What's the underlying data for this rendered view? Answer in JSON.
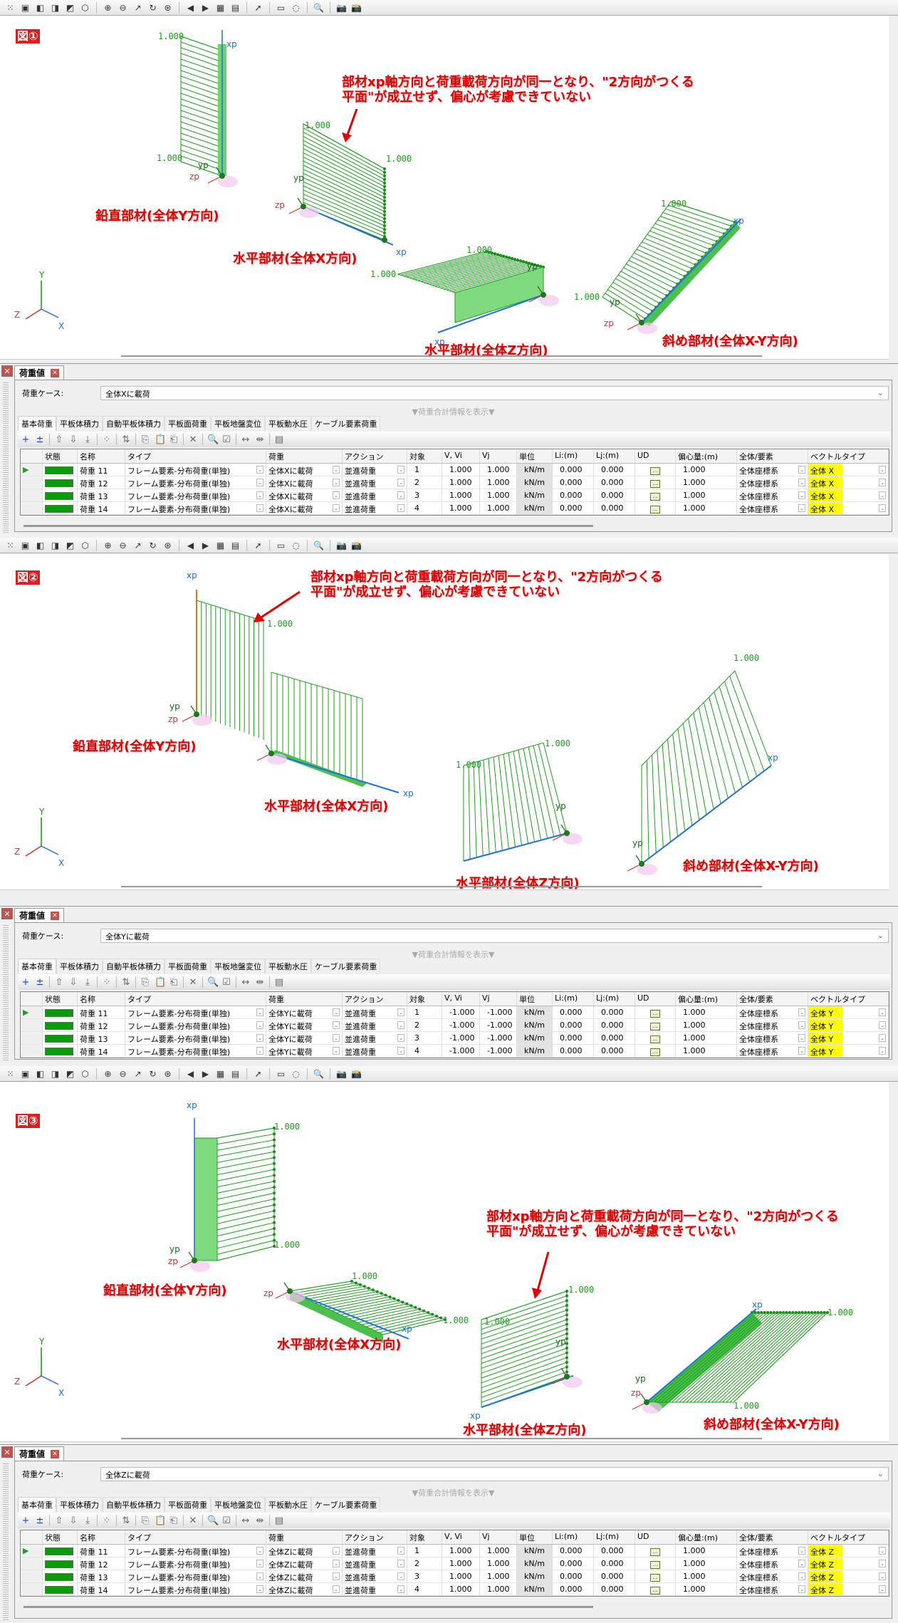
{
  "viewports": [
    {
      "figure_label": "図①",
      "annotation": [
        "部材xp軸方向と荷重載荷方向が同一となり、\"2方向がつくる",
        "平面\"が成立せず、偏心が考慮できていない"
      ],
      "member_labels": {
        "vertical": "鉛直部材(全体Y方向)",
        "horiz_x": "水平部材(全体X方向)",
        "horiz_z": "水平部材(全体Z方向)",
        "diagonal": "斜め部材(全体X-Y方向)"
      }
    },
    {
      "figure_label": "図②",
      "annotation": [
        "部材xp軸方向と荷重載荷方向が同一となり、\"2方向がつくる",
        "平面\"が成立せず、偏心が考慮できていない"
      ],
      "member_labels": {
        "vertical": "鉛直部材(全体Y方向)",
        "horiz_x": "水平部材(全体X方向)",
        "horiz_z": "水平部材(全体Z方向)",
        "diagonal": "斜め部材(全体X-Y方向)"
      }
    },
    {
      "figure_label": "図③",
      "annotation": [
        "部材xp軸方向と荷重載荷方向が同一となり、\"2方向がつくる",
        "平面\"が成立せず、偏心が考慮できていない"
      ],
      "member_labels": {
        "vertical": "鉛直部材(全体Y方向)",
        "horiz_x": "水平部材(全体X方向)",
        "horiz_z": "水平部材(全体Z方向)",
        "diagonal": "斜め部材(全体X-Y方向)"
      }
    }
  ],
  "value_label": "1.000",
  "axes": {
    "x": "X",
    "y": "Y",
    "z": "Z",
    "xp": "xp",
    "yp": "yp",
    "zp": "zp"
  },
  "colors": {
    "load": "#1aa01a",
    "member": "#1e6fe0",
    "annotation": "#e60000",
    "vector_highlight": "#ffff00"
  },
  "panel_common": {
    "tab_title": "荷重値",
    "case_label": "荷重ケース:",
    "info_toggle": "▼荷重合計情報を表示▼",
    "tabs": [
      "基本荷重",
      "平板体積力",
      "自動平板体積力",
      "平板面荷重",
      "平板地盤変位",
      "平板動水圧",
      "ケーブル要素荷重"
    ],
    "columns": [
      "",
      "状態",
      "名称",
      "タイプ",
      "荷重",
      "アクション",
      "対象",
      "V, Vi",
      "Vj",
      "単位",
      "Li:(m)",
      "Lj:(m)",
      "UD",
      "偏心量:(m)",
      "全体/要素",
      "ベクトルタイプ"
    ],
    "ud_button": "…"
  },
  "panels": [
    {
      "case_value": "全体Xに載荷",
      "rows": [
        {
          "name": "荷重 11",
          "type": "フレーム要素-分布荷重(単独)",
          "load": "全体Xに載荷",
          "action": "並進荷重",
          "target": "1",
          "vi": "1.000",
          "vj": "1.000",
          "unit": "kN/m",
          "li": "0.000",
          "lj": "0.000",
          "ecc": "1.000",
          "coord": "全体座標系",
          "vector": "全体 X"
        },
        {
          "name": "荷重 12",
          "type": "フレーム要素-分布荷重(単独)",
          "load": "全体Xに載荷",
          "action": "並進荷重",
          "target": "2",
          "vi": "1.000",
          "vj": "1.000",
          "unit": "kN/m",
          "li": "0.000",
          "lj": "0.000",
          "ecc": "1.000",
          "coord": "全体座標系",
          "vector": "全体 X"
        },
        {
          "name": "荷重 13",
          "type": "フレーム要素-分布荷重(単独)",
          "load": "全体Xに載荷",
          "action": "並進荷重",
          "target": "3",
          "vi": "1.000",
          "vj": "1.000",
          "unit": "kN/m",
          "li": "0.000",
          "lj": "0.000",
          "ecc": "1.000",
          "coord": "全体座標系",
          "vector": "全体 X"
        },
        {
          "name": "荷重 14",
          "type": "フレーム要素-分布荷重(単独)",
          "load": "全体Xに載荷",
          "action": "並進荷重",
          "target": "4",
          "vi": "1.000",
          "vj": "1.000",
          "unit": "kN/m",
          "li": "0.000",
          "lj": "0.000",
          "ecc": "1.000",
          "coord": "全体座標系",
          "vector": "全体 X"
        }
      ]
    },
    {
      "case_value": "全体Yに載荷",
      "rows": [
        {
          "name": "荷重 11",
          "type": "フレーム要素-分布荷重(単独)",
          "load": "全体Yに載荷",
          "action": "並進荷重",
          "target": "1",
          "vi": "-1.000",
          "vj": "-1.000",
          "unit": "kN/m",
          "li": "0.000",
          "lj": "0.000",
          "ecc": "1.000",
          "coord": "全体座標系",
          "vector": "全体 Y"
        },
        {
          "name": "荷重 12",
          "type": "フレーム要素-分布荷重(単独)",
          "load": "全体Yに載荷",
          "action": "並進荷重",
          "target": "2",
          "vi": "-1.000",
          "vj": "-1.000",
          "unit": "kN/m",
          "li": "0.000",
          "lj": "0.000",
          "ecc": "1.000",
          "coord": "全体座標系",
          "vector": "全体 Y"
        },
        {
          "name": "荷重 13",
          "type": "フレーム要素-分布荷重(単独)",
          "load": "全体Yに載荷",
          "action": "並進荷重",
          "target": "3",
          "vi": "-1.000",
          "vj": "-1.000",
          "unit": "kN/m",
          "li": "0.000",
          "lj": "0.000",
          "ecc": "1.000",
          "coord": "全体座標系",
          "vector": "全体 Y"
        },
        {
          "name": "荷重 14",
          "type": "フレーム要素-分布荷重(単独)",
          "load": "全体Yに載荷",
          "action": "並進荷重",
          "target": "4",
          "vi": "-1.000",
          "vj": "-1.000",
          "unit": "kN/m",
          "li": "0.000",
          "lj": "0.000",
          "ecc": "1.000",
          "coord": "全体座標系",
          "vector": "全体 Y"
        }
      ]
    },
    {
      "case_value": "全体Zに載荷",
      "rows": [
        {
          "name": "荷重 11",
          "type": "フレーム要素-分布荷重(単独)",
          "load": "全体Zに載荷",
          "action": "並進荷重",
          "target": "1",
          "vi": "1.000",
          "vj": "1.000",
          "unit": "kN/m",
          "li": "0.000",
          "lj": "0.000",
          "ecc": "1.000",
          "coord": "全体座標系",
          "vector": "全体 Z"
        },
        {
          "name": "荷重 12",
          "type": "フレーム要素-分布荷重(単独)",
          "load": "全体Zに載荷",
          "action": "並進荷重",
          "target": "2",
          "vi": "1.000",
          "vj": "1.000",
          "unit": "kN/m",
          "li": "0.000",
          "lj": "0.000",
          "ecc": "1.000",
          "coord": "全体座標系",
          "vector": "全体 Z"
        },
        {
          "name": "荷重 13",
          "type": "フレーム要素-分布荷重(単独)",
          "load": "全体Zに載荷",
          "action": "並進荷重",
          "target": "3",
          "vi": "1.000",
          "vj": "1.000",
          "unit": "kN/m",
          "li": "0.000",
          "lj": "0.000",
          "ecc": "1.000",
          "coord": "全体座標系",
          "vector": "全体 Z"
        },
        {
          "name": "荷重 14",
          "type": "フレーム要素-分布荷重(単独)",
          "load": "全体Zに載荷",
          "action": "並進荷重",
          "target": "4",
          "vi": "1.000",
          "vj": "1.000",
          "unit": "kN/m",
          "li": "0.000",
          "lj": "0.000",
          "ecc": "1.000",
          "coord": "全体座標系",
          "vector": "全体 Z"
        }
      ]
    }
  ]
}
